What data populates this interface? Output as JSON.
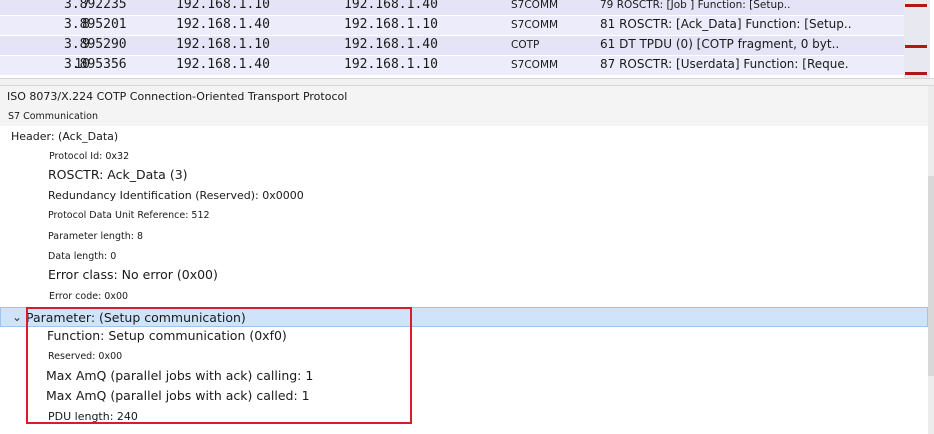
{
  "packets": [
    {
      "no": "7",
      "time": "3.892235",
      "src": "192.168.1.10",
      "dst": "192.168.1.40",
      "proto": "S7COMM",
      "info": "79 ROSCTR: [Job           ] Function: [Setup.."
    },
    {
      "no": "8",
      "time": "3.895201",
      "src": "192.168.1.40",
      "dst": "192.168.1.10",
      "proto": "S7COMM",
      "info": "81 ROSCTR: [Ack_Data] Function: [Setup.."
    },
    {
      "no": "9",
      "time": "3.895290",
      "src": "192.168.1.10",
      "dst": "192.168.1.40",
      "proto": "COTP",
      "info": "61 DT TPDU (0) [COTP fragment, 0 byt.."
    },
    {
      "no": "10",
      "time": "3.895356",
      "src": "192.168.1.40",
      "dst": "192.168.1.10",
      "proto": "S7COMM",
      "info": "87 ROSCTR: [Userdata] Function: [Reque."
    }
  ],
  "details": {
    "cotp": "ISO 8073/X.224 COTP Connection-Oriented Transport Protocol",
    "s7": "S7 Communication",
    "header": "Header: (Ack_Data)",
    "protocol_id": "Protocol Id: 0x32",
    "rosctr": "ROSCTR: Ack_Data (3)",
    "redundancy": "Redundancy Identification (Reserved): 0x0000",
    "pdu_ref": "Protocol Data Unit Reference: 512",
    "param_len": "Parameter length: 8",
    "data_len": "Data length: 0",
    "error_class": "Error class: No error (0x00)",
    "error_code": "Error code: 0x00",
    "parameter": "Parameter: (Setup communication)",
    "function": "Function: Setup communication (0xf0)",
    "reserved": "Reserved: 0x00",
    "amq_calling": "Max AmQ (parallel jobs with ack) calling: 1",
    "amq_called": "Max AmQ (parallel jobs with ack) called: 1",
    "pdu_length": "PDU length: 240"
  },
  "icons": {
    "expanded": "chevron-down-icon"
  },
  "colors": {
    "highlight_box": "#d21f2b",
    "selected_row": "#cfe4fb",
    "packet_row": "#e4e4f6"
  }
}
